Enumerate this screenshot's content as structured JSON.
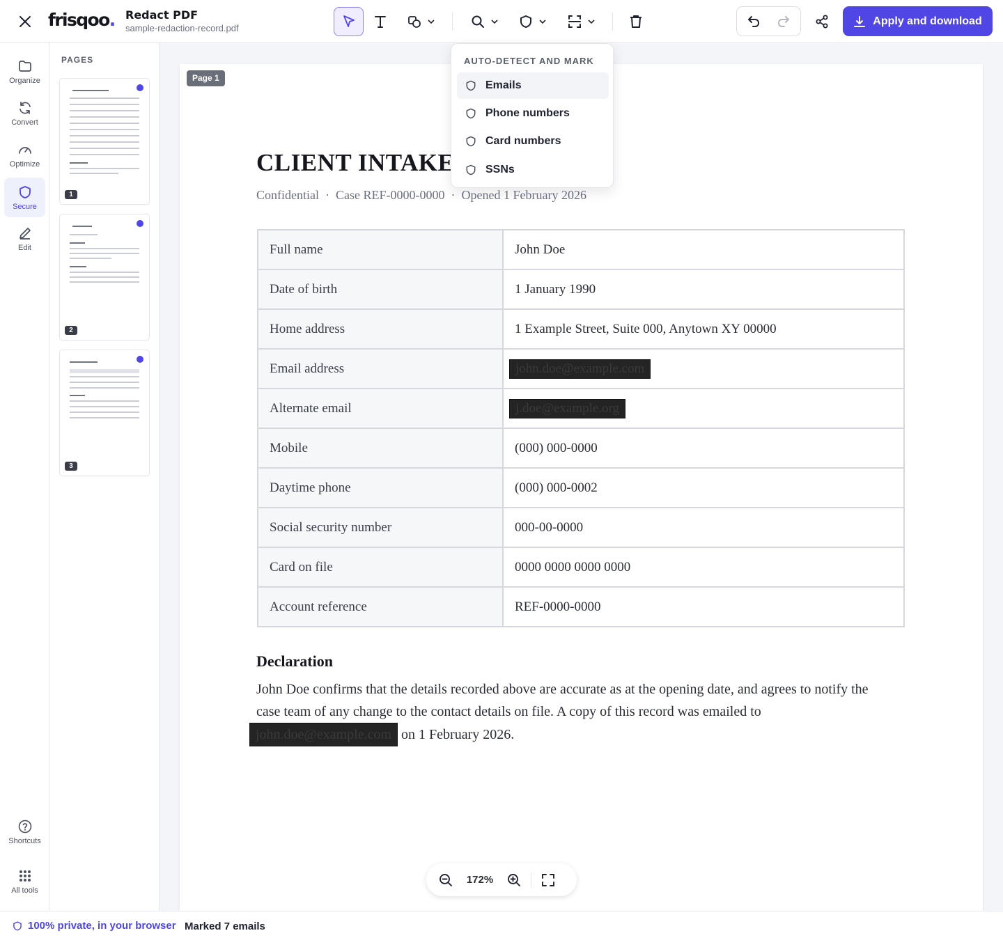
{
  "header": {
    "brand": "frisqoo",
    "brand_dot": ".",
    "app_title": "Redact PDF",
    "file_name": "sample-redaction-record.pdf",
    "apply_label": "Apply and download"
  },
  "rail": {
    "items": [
      {
        "label": "Organize",
        "icon": "folder-icon"
      },
      {
        "label": "Convert",
        "icon": "refresh-icon"
      },
      {
        "label": "Optimize",
        "icon": "gauge-icon"
      },
      {
        "label": "Secure",
        "icon": "shield-icon",
        "active": true
      },
      {
        "label": "Edit",
        "icon": "pencil-icon"
      }
    ],
    "shortcuts_label": "Shortcuts",
    "all_tools_label": "All tools"
  },
  "pages": {
    "title": "PAGES",
    "thumbs": [
      {
        "num": "1",
        "marked": true
      },
      {
        "num": "2",
        "marked": true
      },
      {
        "num": "3",
        "marked": true
      }
    ]
  },
  "document": {
    "page_badge": "Page 1",
    "heading": "CLIENT INTAKE",
    "meta": [
      "Confidential",
      "Case REF-0000-0000",
      "Opened 1 February 2026"
    ],
    "meta_sep": "·",
    "rows": [
      {
        "label": "Full name",
        "value": "John Doe",
        "redacted": false
      },
      {
        "label": "Date of birth",
        "value": "1 January 1990",
        "redacted": false
      },
      {
        "label": "Home address",
        "value": "1 Example Street, Suite 000, Anytown XY 00000",
        "redacted": false
      },
      {
        "label": "Email address",
        "value": "john.doe@example.com",
        "redacted": true
      },
      {
        "label": "Alternate email",
        "value": "j.doe@example.org",
        "redacted": true
      },
      {
        "label": "Mobile",
        "value": "(000) 000-0000",
        "redacted": false
      },
      {
        "label": "Daytime phone",
        "value": "(000) 000-0002",
        "redacted": false
      },
      {
        "label": "Social security number",
        "value": "000-00-0000",
        "redacted": false
      },
      {
        "label": "Card on file",
        "value": "0000 0000 0000 0000",
        "redacted": false
      },
      {
        "label": "Account reference",
        "value": "REF-0000-0000",
        "redacted": false
      }
    ],
    "declaration_heading": "Declaration",
    "declaration_text": "John Doe confirms that the details recorded above are accurate as at the opening date, and agrees to notify the case team of any change to the contact details on file. A copy of this record was emailed to",
    "declaration_email": "john.doe@example.com",
    "declaration_tail": "on 1 February 2026."
  },
  "zoom": {
    "value": "172%"
  },
  "dropdown": {
    "title": "AUTO-DETECT AND MARK",
    "items": [
      "Emails",
      "Phone numbers",
      "Card numbers",
      "SSNs"
    ]
  },
  "status": {
    "privacy": "100% private, in your browser",
    "message": "Marked 7 emails"
  },
  "colors": {
    "accent": "#4f46e5",
    "redaction": "#242424"
  }
}
